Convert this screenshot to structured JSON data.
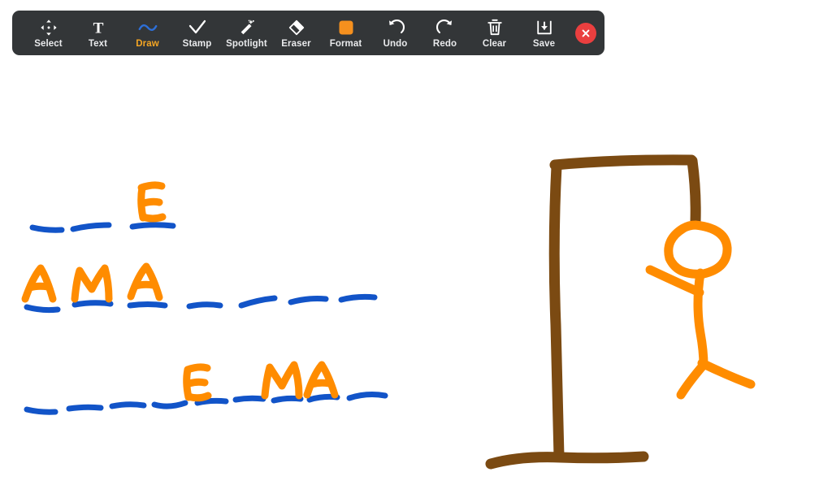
{
  "app": {
    "name": "Zoom Whiteboard Annotation",
    "background_color": "#ffffff"
  },
  "toolbar": {
    "background_color": "#333638",
    "label_color": "#e9eaec",
    "active_color": "#f5a623",
    "active_tool": "Draw",
    "items": [
      {
        "id": "select",
        "label": "Select",
        "icon": "move-arrows-icon",
        "active": false
      },
      {
        "id": "text",
        "label": "Text",
        "icon": "text-t-icon",
        "active": false
      },
      {
        "id": "draw",
        "label": "Draw",
        "icon": "squiggle-line-icon",
        "active": true
      },
      {
        "id": "stamp",
        "label": "Stamp",
        "icon": "checkmark-icon",
        "active": false
      },
      {
        "id": "spotlight",
        "label": "Spotlight",
        "icon": "magic-wand-icon",
        "active": false
      },
      {
        "id": "eraser",
        "label": "Eraser",
        "icon": "eraser-icon",
        "active": false
      },
      {
        "id": "format",
        "label": "Format",
        "icon": "color-swatch-icon",
        "active": false
      },
      {
        "id": "undo",
        "label": "Undo",
        "icon": "undo-arrow-icon",
        "active": false
      },
      {
        "id": "redo",
        "label": "Redo",
        "icon": "redo-arrow-icon",
        "active": false
      },
      {
        "id": "clear",
        "label": "Clear",
        "icon": "trash-can-icon",
        "active": false
      },
      {
        "id": "save",
        "label": "Save",
        "icon": "save-download-icon",
        "active": false
      }
    ],
    "close_button": {
      "icon": "close-x-icon",
      "color": "#ea3f3f"
    }
  },
  "drawing": {
    "title": "Hangman game drawing",
    "ink_colors": {
      "letter_orange": "#FF8C00",
      "blank_blue": "#1254C8",
      "gallows_brown": "#7B4A12"
    },
    "puzzle": {
      "description": "Three rows of blank slots with some letters revealed",
      "rows": [
        {
          "row": 1,
          "slot_count": 3,
          "letters": [
            "",
            "",
            "E"
          ]
        },
        {
          "row": 2,
          "slot_count": 7,
          "letters": [
            "A",
            "M",
            "A",
            "",
            "",
            "",
            ""
          ]
        },
        {
          "row": 3,
          "slot_count": 9,
          "letters": [
            "",
            "",
            "",
            "",
            "E",
            "",
            "M",
            "A",
            ""
          ]
        }
      ]
    },
    "hangman": {
      "gallows_parts": [
        "vertical-post",
        "top-beam",
        "rope-stub",
        "base"
      ],
      "figure_parts": [
        "head",
        "body",
        "arm-left",
        "leg-left",
        "leg-right"
      ],
      "figure_color": "#FF8C00"
    }
  }
}
